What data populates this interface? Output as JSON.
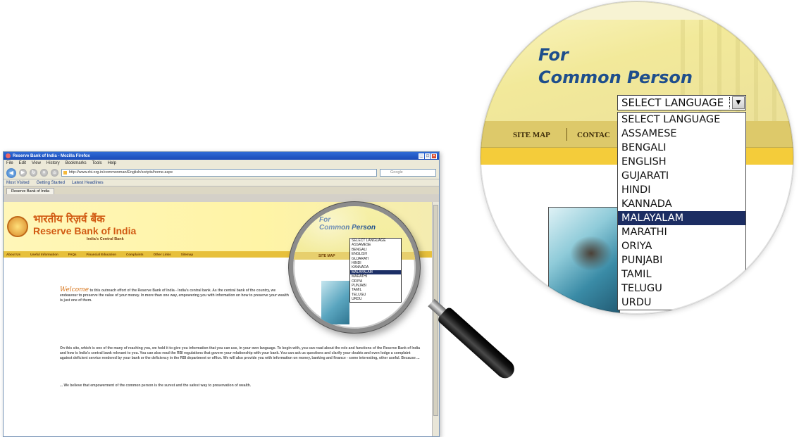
{
  "browser": {
    "title": "Reserve Bank of India - Mozilla Firefox",
    "menu": [
      "File",
      "Edit",
      "View",
      "History",
      "Bookmarks",
      "Tools",
      "Help"
    ],
    "url": "http://www.rbi.org.in/commonman/English/scripts/home.aspx",
    "search_placeholder": "Google",
    "bookmarks": [
      "Most Visited",
      "Getting Started",
      "Latest Headlines"
    ],
    "tab_label": "Reserve Bank of India"
  },
  "site": {
    "name_hindi": "भारतीय रिज़र्व बैंक",
    "name_english": "Reserve Bank of India",
    "tagline": "India's Central Bank",
    "nav": [
      "About Us",
      "Useful Information",
      "FAQs",
      "Financial Education",
      "Complaints",
      "Other Links",
      "Sitemap"
    ],
    "welcome_word": "Welcome",
    "welcome_text": "to this outreach effort of the Reserve Bank of India - India's central bank. As the central bank of the country, we endeavour to preserve the value of your money. In more than one way, empowering you with information on how to preserve your wealth is just one of them.",
    "para2": "On this site, which is one of the many of reaching you, we hold it to give you information that you can use, in your own language. To begin with, you can read about the role and functions of the Reserve Bank of India and how is India's central bank relevant to you. You can also read the RBI regulations that govern your relationship with your bank. You can ask us questions and clarify your doubts and even lodge a complaint against deficient service rendered by your bank or the deficiency in the RBI department or office. We will also provide you with information on money, banking and finance - some interesting, other useful. Because ...",
    "para3": "... We believe that empowerment of the common person is the surest and the safest way to preservation of wealth."
  },
  "zoom": {
    "for_line1": "For",
    "for_line2": "Common Person",
    "select_value": "SELECT LANGUAGE",
    "nav_site_map": "SITE MAP",
    "nav_contact": "CONTAC",
    "languages": [
      "SELECT LANGUAGE",
      "ASSAMESE",
      "BENGALI",
      "ENGLISH",
      "GUJARATI",
      "HINDI",
      "KANNADA",
      "MALAYALAM",
      "MARATHI",
      "ORIYA",
      "PUNJABI",
      "TAMIL",
      "TELUGU",
      "URDU"
    ],
    "highlighted": "MALAYALAM"
  },
  "colors": {
    "accent_blue": "#1e4e8c",
    "highlight_navy": "#1c2d62",
    "nav_gold": "#ddc96a",
    "band_yellow": "#f4cc3a",
    "rbi_orange": "#d15a12"
  },
  "icons": [
    "magnifier-icon",
    "dropdown-arrow-icon",
    "back-icon",
    "forward-icon",
    "reload-icon",
    "stop-icon",
    "home-icon"
  ]
}
